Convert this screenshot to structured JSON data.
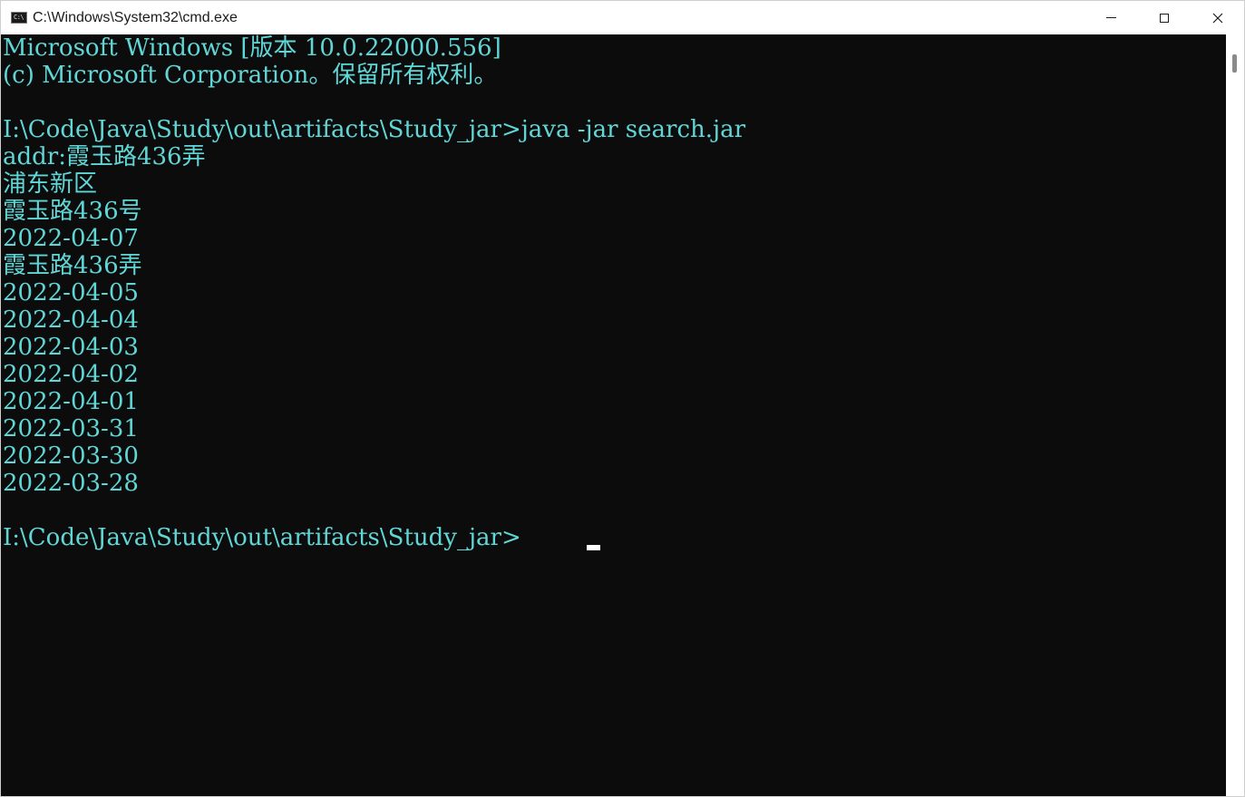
{
  "window": {
    "title": "C:\\Windows\\System32\\cmd.exe",
    "icon": "console-app-icon",
    "icon_text": "C:\\",
    "controls": [
      "minimize-icon",
      "maximize-icon",
      "close-icon"
    ],
    "close_glyph": "✕"
  },
  "colors": {
    "console_background": "#0c0c0c",
    "console_text": "#61d6d6",
    "titlebar_background": "#ffffff"
  },
  "console": {
    "lines": [
      "Microsoft Windows [版本 10.0.22000.556]",
      "(c) Microsoft Corporation。保留所有权利。",
      "",
      "I:\\Code\\Java\\Study\\out\\artifacts\\Study_jar>java -jar search.jar",
      "addr:霞玉路436弄",
      "浦东新区",
      "霞玉路436号",
      "2022-04-07",
      "霞玉路436弄",
      "2022-04-05",
      "2022-04-04",
      "2022-04-03",
      "2022-04-02",
      "2022-04-01",
      "2022-03-31",
      "2022-03-30",
      "2022-03-28",
      "",
      "I:\\Code\\Java\\Study\\out\\artifacts\\Study_jar>"
    ]
  }
}
